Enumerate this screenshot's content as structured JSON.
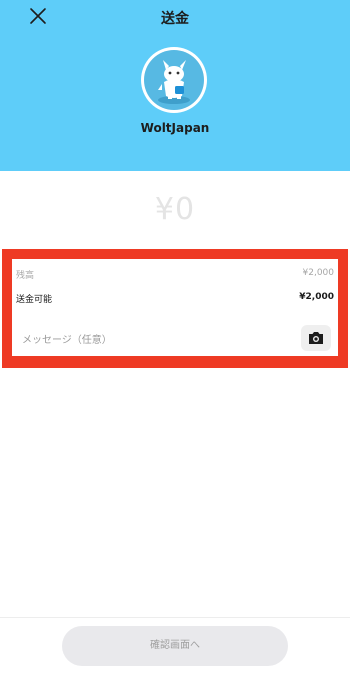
{
  "header": {
    "title": "送金",
    "close_icon": "close-icon",
    "recipient_name": "WoltJapan",
    "avatar_icon": "wolt-mascot-avatar",
    "background_color": "#5ecdf9"
  },
  "amount": {
    "value": "¥0"
  },
  "balance_panel": {
    "balance_label": "残高",
    "balance_value": "¥2,000",
    "available_label": "送金可能",
    "available_value": "¥2,000",
    "message_placeholder": "メッセージ（任意）",
    "camera_icon": "camera-icon",
    "highlight_color": "#ee3a24"
  },
  "footer": {
    "confirm_label": "確認画面へ"
  }
}
